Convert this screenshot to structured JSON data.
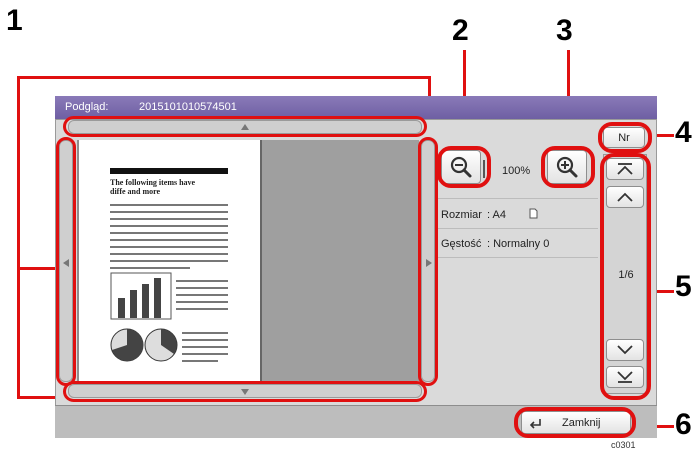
{
  "callouts": [
    "1",
    "2",
    "3",
    "4",
    "5",
    "6"
  ],
  "title": {
    "label": "Podgląd:",
    "value": "2015101010574501"
  },
  "zoom": {
    "value": "100%",
    "out_icon": "zoom-out-icon",
    "in_icon": "zoom-in-icon"
  },
  "info": {
    "size_label": "Rozmiar",
    "size_value": ": A4",
    "density_label": "Gęstość",
    "density_value": ": Normalny 0"
  },
  "nav": {
    "nr_label": "Nr",
    "page": "1/6"
  },
  "doc": {
    "heading_line1": "The following items have",
    "heading_line2": "diffe and more"
  },
  "close_label": "Zamknij",
  "code": "c0301",
  "colors": {
    "accent": "#e01010",
    "titlebar": "#6e5fa3"
  }
}
